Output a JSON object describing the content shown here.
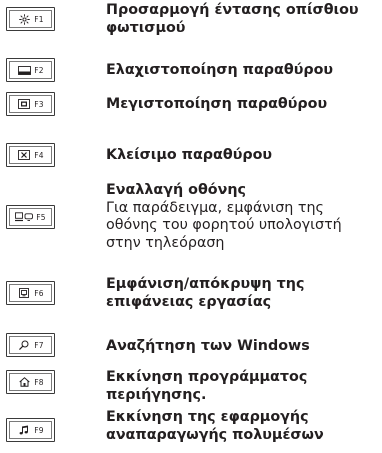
{
  "rows": [
    {
      "key": "F1",
      "icon": "brightness-icon",
      "title": "Προσαρμογή έντασης οπίσθιου φωτισμού"
    },
    {
      "key": "F2",
      "icon": "minimize-window-icon",
      "title": "Ελαχιστοποίηση παραθύρου"
    },
    {
      "key": "F3",
      "icon": "maximize-window-icon",
      "title": "Μεγιστοποίηση παραθύρου"
    },
    {
      "key": "F4",
      "icon": "close-window-icon",
      "title": "Κλείσιμο παραθύρου"
    },
    {
      "key": "F5",
      "icon": "display-switch-icon",
      "title": "Εναλλαγή οθόνης",
      "detail": "Για παράδειγμα, εμφάνιση της οθόνης του φορητού υπολογιστή στην τηλεόραση"
    },
    {
      "key": "F6",
      "icon": "show-desktop-icon",
      "title": "Εμφάνιση/απόκρυψη της επιφάνειας εργασίας"
    },
    {
      "key": "F7",
      "icon": "search-icon",
      "title": "Αναζήτηση των Windows"
    },
    {
      "key": "F8",
      "icon": "home-icon",
      "title": "Εκκίνηση προγράμματος περιήγησης."
    },
    {
      "key": "F9",
      "icon": "music-note-icon",
      "title": "Εκκίνηση της εφαρμογής αναπαραγωγής πολυμέσων"
    }
  ]
}
